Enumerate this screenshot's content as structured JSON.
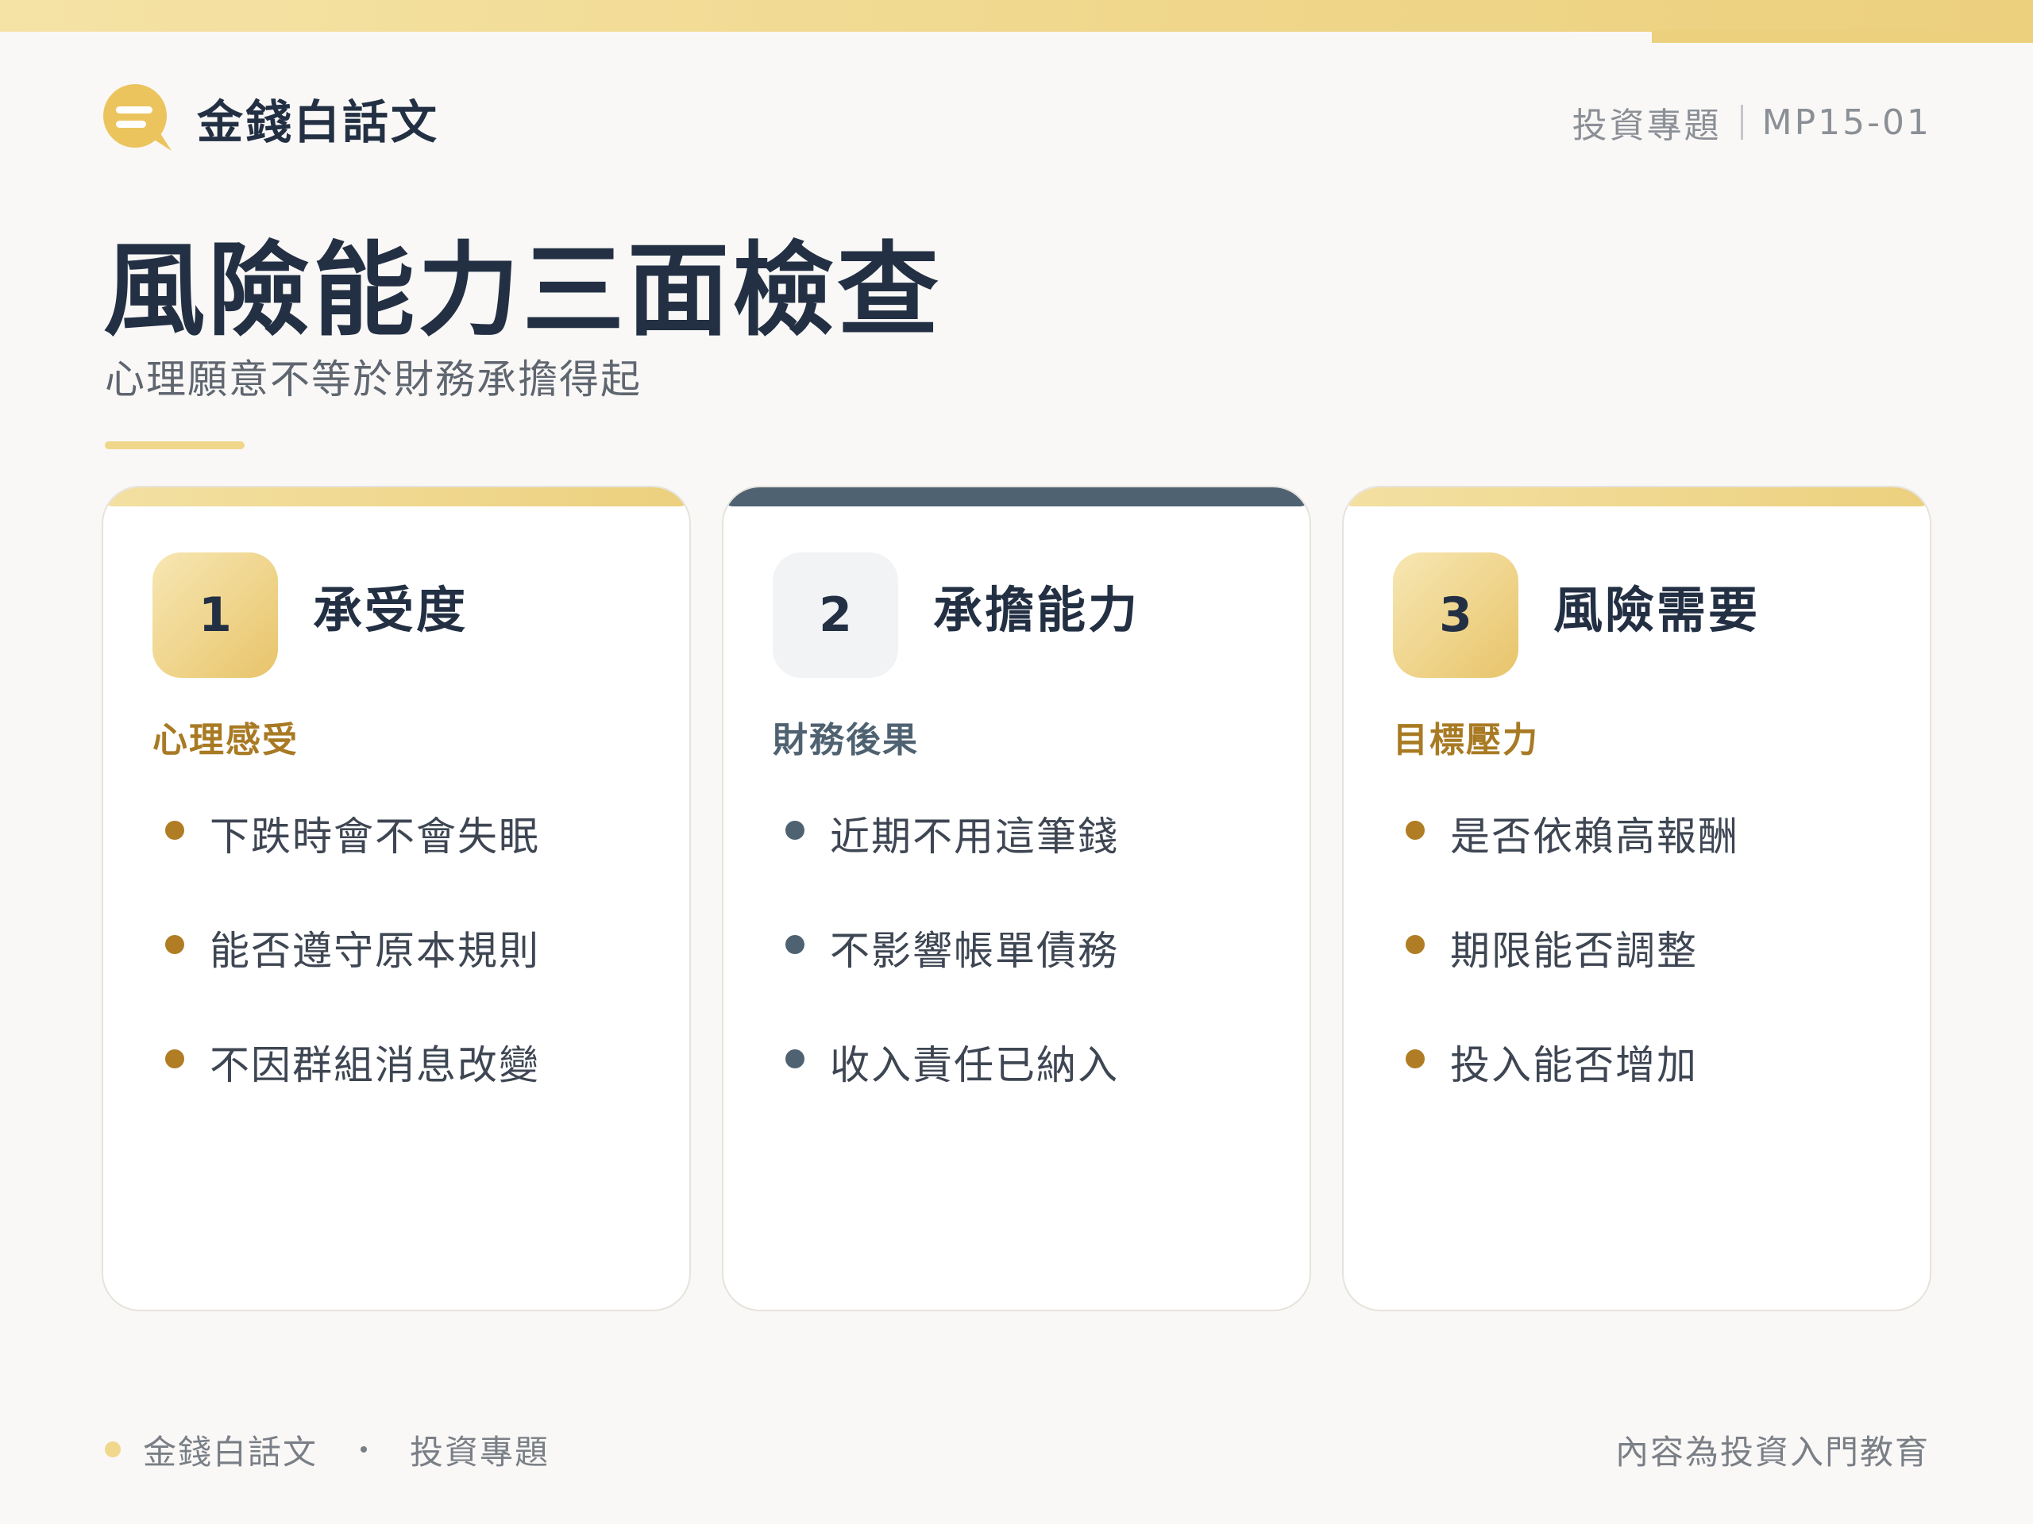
{
  "brand": {
    "name": "金錢白話文"
  },
  "header": {
    "category": "投資專題",
    "code": "MP15-01"
  },
  "title": "風險能力三面檢查",
  "subtitle": "心理願意不等於財務承擔得起",
  "cards": [
    {
      "number": "1",
      "title": "承受度",
      "tag": "心理感受",
      "items": [
        "下跌時會不會失眠",
        "能否遵守原本規則",
        "不因群組消息改變"
      ]
    },
    {
      "number": "2",
      "title": "承擔能力",
      "tag": "財務後果",
      "items": [
        "近期不用這筆錢",
        "不影響帳單債務",
        "收入責任已納入"
      ]
    },
    {
      "number": "3",
      "title": "風險需要",
      "tag": "目標壓力",
      "items": [
        "是否依賴高報酬",
        "期限能否調整",
        "投入能否增加"
      ]
    }
  ],
  "footer": {
    "brand": "金錢白話文",
    "category": "投資專題",
    "note": "內容為投資入門教育"
  },
  "colors": {
    "gold": "#ecd07e",
    "gold_text": "#a87a23",
    "slate": "#4f6272",
    "navy": "#233044"
  }
}
